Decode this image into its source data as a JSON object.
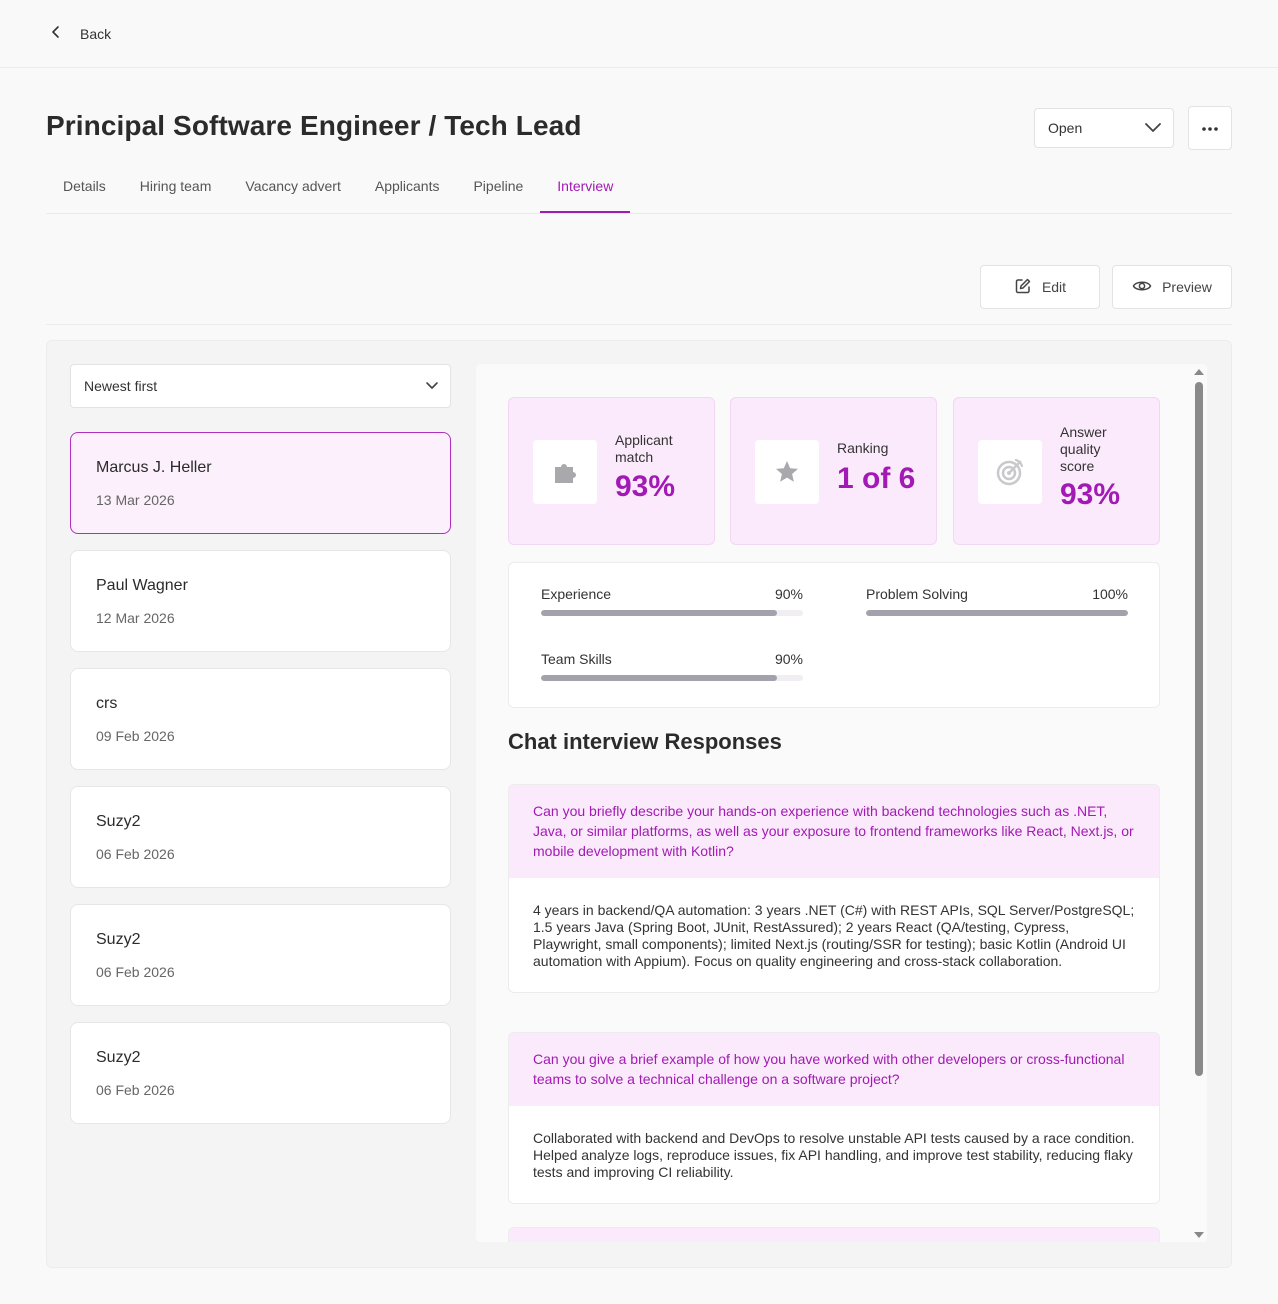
{
  "nav": {
    "back_label": "Back"
  },
  "page": {
    "title": "Principal Software Engineer / Tech Lead"
  },
  "status_select": {
    "value": "Open"
  },
  "tabs": [
    {
      "label": "Details"
    },
    {
      "label": "Hiring team"
    },
    {
      "label": "Vacancy advert"
    },
    {
      "label": "Applicants"
    },
    {
      "label": "Pipeline"
    },
    {
      "label": "Interview",
      "active": true
    }
  ],
  "actions": {
    "edit_label": "Edit",
    "preview_label": "Preview"
  },
  "sort_select": {
    "value": "Newest first"
  },
  "candidates": [
    {
      "name": "Marcus J. Heller",
      "date": "13 Mar 2026",
      "selected": true
    },
    {
      "name": "Paul Wagner",
      "date": "12 Mar 2026"
    },
    {
      "name": "crs",
      "date": "09 Feb 2026"
    },
    {
      "name": "Suzy2",
      "date": "06 Feb 2026"
    },
    {
      "name": "Suzy2",
      "date": "06 Feb 2026"
    },
    {
      "name": "Suzy2",
      "date": "06 Feb 2026"
    }
  ],
  "stats": [
    {
      "label_line1": "Applicant",
      "label_line2": "match",
      "label_line3": "",
      "value": "93%",
      "icon": "puzzle-icon"
    },
    {
      "label_line1": "Ranking",
      "label_line2": "",
      "label_line3": "",
      "value": "1 of 6",
      "icon": "star-icon"
    },
    {
      "label_line1": "Answer",
      "label_line2": "quality",
      "label_line3": "score",
      "value": "93%",
      "icon": "target-icon"
    }
  ],
  "skills": [
    {
      "name": "Experience",
      "percent_label": "90%",
      "level": 0.9
    },
    {
      "name": "Problem Solving",
      "percent_label": "100%",
      "level": 1.0
    },
    {
      "name": "Team Skills",
      "percent_label": "90%",
      "level": 0.9
    }
  ],
  "responses": {
    "title": "Chat interview Responses",
    "items": [
      {
        "question": "Can you briefly describe your hands-on experience with backend technologies such as .NET, Java, or similar platforms, as well as your exposure to frontend frameworks like React, Next.js, or mobile development with Kotlin?",
        "answer": "4 years in backend/QA automation: 3 years .NET (C#) with REST APIs, SQL Server/PostgreSQL; 1.5 years Java (Spring Boot, JUnit, RestAssured); 2 years React (QA/testing, Cypress, Playwright, small components); limited Next.js (routing/SSR for testing); basic Kotlin (Android UI automation with Appium). Focus on quality engineering and cross-stack collaboration."
      },
      {
        "question": "Can you give a brief example of how you have worked with other developers or cross-functional teams to solve a technical challenge on a software project?",
        "answer": "Collaborated with backend and DevOps to resolve unstable API tests caused by a race condition. Helped analyze logs, reproduce issues, fix API handling, and improve test stability, reducing flaky tests and improving CI reliability."
      }
    ]
  },
  "colors": {
    "accent": "#a21ab4",
    "accent_bg": "#fbeafb",
    "bar_fill": "#a3a1ab"
  }
}
